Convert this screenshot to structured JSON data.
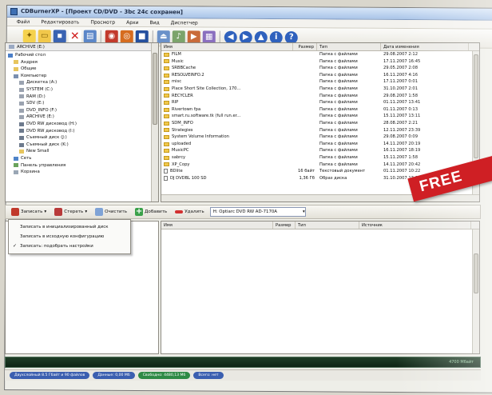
{
  "window": {
    "title": "CDBurnerXP - [Проект CD/DVD - 3bc 24c сохранен]"
  },
  "menu": [
    "Файл",
    "Редактировать",
    "Просмотр",
    "Архи",
    "Вид",
    "Диспетчер"
  ],
  "colors": {
    "accent": "#cf1f24",
    "folder": "#f1c84b"
  },
  "tree": {
    "top_label": "ARCHIVE (E:)",
    "items": [
      "Рабочий стол",
      "Андрея",
      "Общие",
      "Компьютер",
      "Дискетка (A:)",
      "SYSTEM (C:)",
      "RAM (D:)",
      "SDV (E:)",
      "DVD_INFO (F:)",
      "ARCHIVE (E:)",
      "DVD RW дисковод (H:)",
      "DVD RW дисковод (I:)",
      "Съемный диск (J:)",
      "Съемный диск (K:)",
      "New Small",
      "Сеть",
      "Панель управления",
      "Корзина"
    ]
  },
  "file_list": {
    "headers": {
      "name": "Имя",
      "size": "Размер",
      "type": "Тип",
      "date": "Дата изменения"
    },
    "rows": [
      {
        "name": "FILM",
        "size": "",
        "type": "Папка с файлами",
        "date": "29.08.2007 2:12"
      },
      {
        "name": "Music",
        "size": "",
        "type": "Папка с файлами",
        "date": "17.11.2007 16:45"
      },
      {
        "name": "SRBBCache",
        "size": "",
        "type": "Папка с файлами",
        "date": "29.05.2007 2:08"
      },
      {
        "name": "RESOLVEINFO.2",
        "size": "",
        "type": "Папка с файлами",
        "date": "16.11.2007 4:16"
      },
      {
        "name": "misc",
        "size": "",
        "type": "Папка с файлами",
        "date": "17.11.2007 0:01"
      },
      {
        "name": "Place Short Site Collection, 170...",
        "size": "",
        "type": "Папка с файлами",
        "date": "31.10.2007 2:01"
      },
      {
        "name": "RECYCLER",
        "size": "",
        "type": "Папка с файлами",
        "date": "29.08.2007 1:58"
      },
      {
        "name": "RIP",
        "size": "",
        "type": "Папка с файлами",
        "date": "01.11.2007 13:41"
      },
      {
        "name": "Rivertown fpa",
        "size": "",
        "type": "Папка с файлами",
        "date": "01.11.2007 0:13"
      },
      {
        "name": "smart.ru.software.tk (full run.er...",
        "size": "",
        "type": "Папка с файлами",
        "date": "15.11.2007 13:11"
      },
      {
        "name": "SDM_INFO",
        "size": "",
        "type": "Папка с файлами",
        "date": "28.08.2007 2:21"
      },
      {
        "name": "Strategies",
        "size": "",
        "type": "Папка с файлами",
        "date": "12.11.2007 23:39"
      },
      {
        "name": "System Volume Information",
        "size": "",
        "type": "Папка с файлами",
        "date": "29.08.2007 0:09"
      },
      {
        "name": "uploaded",
        "size": "",
        "type": "Папка с файлами",
        "date": "14.11.2007 20:19"
      },
      {
        "name": "MusicPC",
        "size": "",
        "type": "Папка с файлами",
        "date": "16.11.2007 18:19"
      },
      {
        "name": "sabrcy",
        "size": "",
        "type": "Папка с файлами",
        "date": "15.11.2007 1:58"
      },
      {
        "name": "XP_Copy",
        "size": "",
        "type": "Папка с файлами",
        "date": "14.11.2007 20:42"
      },
      {
        "name": "BDlite",
        "size": "16 байт",
        "type": "Текстовый документ",
        "date": "01.11.2007 10:22"
      },
      {
        "name": "DJ DVDBL 100 SD",
        "size": "1,36 Гб",
        "type": "Образ диска",
        "date": "31.10.2007 13:04"
      }
    ]
  },
  "actionbar": {
    "write": "Записать",
    "erase": "Стереть",
    "clear": "Очистить",
    "add": "Добавить",
    "remove": "Удалить",
    "device": "H: Optiarc DVD RW AD-7170A"
  },
  "write_menu": {
    "items": [
      {
        "label": "Записать в инициализированный диск",
        "checked": false
      },
      {
        "label": "Записать в исходную конфигурацию",
        "checked": false
      },
      {
        "label": "Записать: подобрать настройки",
        "checked": true
      }
    ]
  },
  "compilation": {
    "headers": {
      "name": "Имя",
      "size": "Размер",
      "type": "Тип",
      "note": "Источник"
    },
    "rows": []
  },
  "progress": {
    "value": 0.0,
    "label": "4700 Мбайт"
  },
  "status": {
    "pills": [
      {
        "label": "Двухслойный 8.5 Гбайт и 90 файлов",
        "color": "#3b5fb0"
      },
      {
        "label": "Данные: 0,00 Мб",
        "color": "#3b5fb0"
      },
      {
        "label": "Свободно: 4480,13 Мб",
        "color": "#2e8a45"
      },
      {
        "label": "Всего: нет",
        "color": "#3b5fb0"
      }
    ]
  },
  "banner": {
    "text": "FREE"
  }
}
